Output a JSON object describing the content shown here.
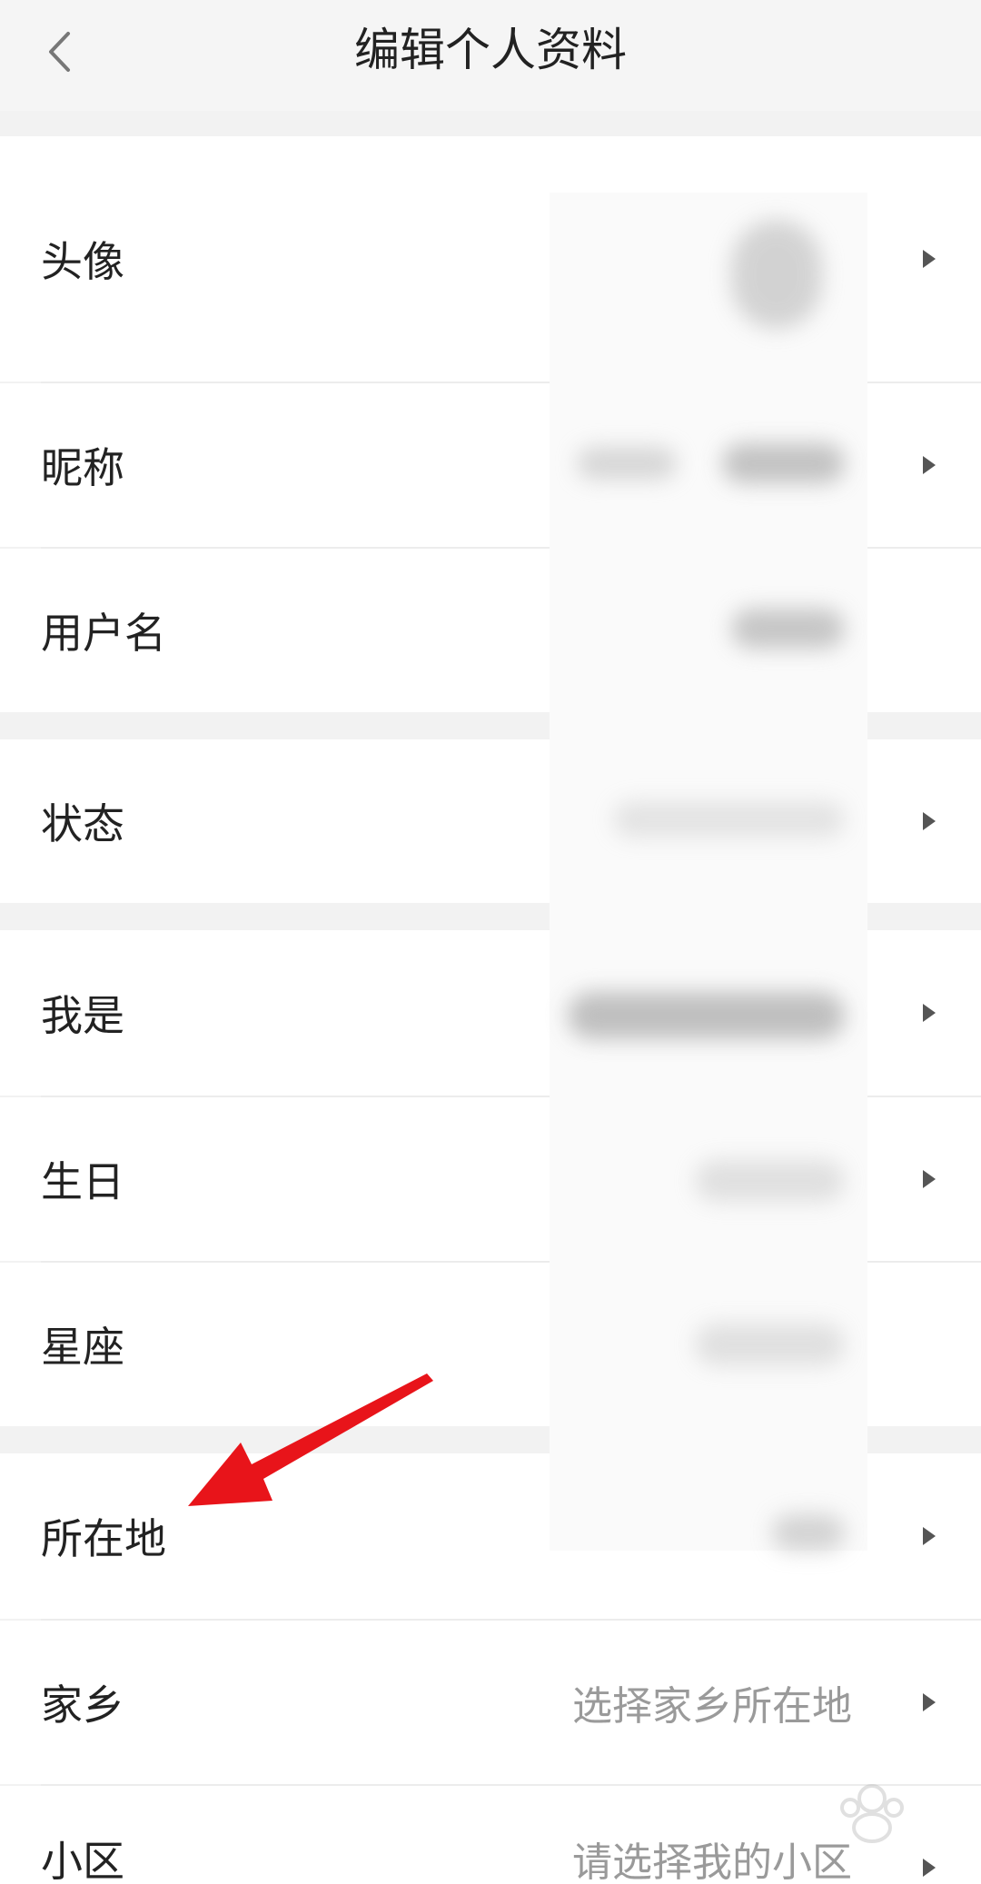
{
  "header": {
    "title": "编辑个人资料",
    "back_icon": "chevron-left-icon"
  },
  "rows": [
    {
      "id": "avatar",
      "label": "头像",
      "value": "",
      "has_arrow": true
    },
    {
      "id": "nickname",
      "label": "昵称",
      "value": "",
      "has_arrow": true
    },
    {
      "id": "username",
      "label": "用户名",
      "value": "",
      "has_arrow": false
    },
    {
      "id": "status",
      "label": "状态",
      "value": "",
      "has_arrow": true
    },
    {
      "id": "identity",
      "label": "我是",
      "value": "",
      "has_arrow": true
    },
    {
      "id": "birthday",
      "label": "生日",
      "value": "",
      "has_arrow": true
    },
    {
      "id": "zodiac",
      "label": "星座",
      "value": "",
      "has_arrow": false
    },
    {
      "id": "location",
      "label": "所在地",
      "value": "",
      "has_arrow": true
    },
    {
      "id": "hometown",
      "label": "家乡",
      "value": "选择家乡所在地",
      "has_arrow": true
    },
    {
      "id": "community",
      "label": "小区",
      "value": "请选择我的小区",
      "has_arrow": true
    }
  ],
  "annotation": {
    "color": "#e8141a"
  },
  "colors": {
    "background": "#f2f2f2",
    "row": "#ffffff",
    "label": "#222222",
    "value": "#9a9a9a",
    "arrow": "#555555"
  }
}
